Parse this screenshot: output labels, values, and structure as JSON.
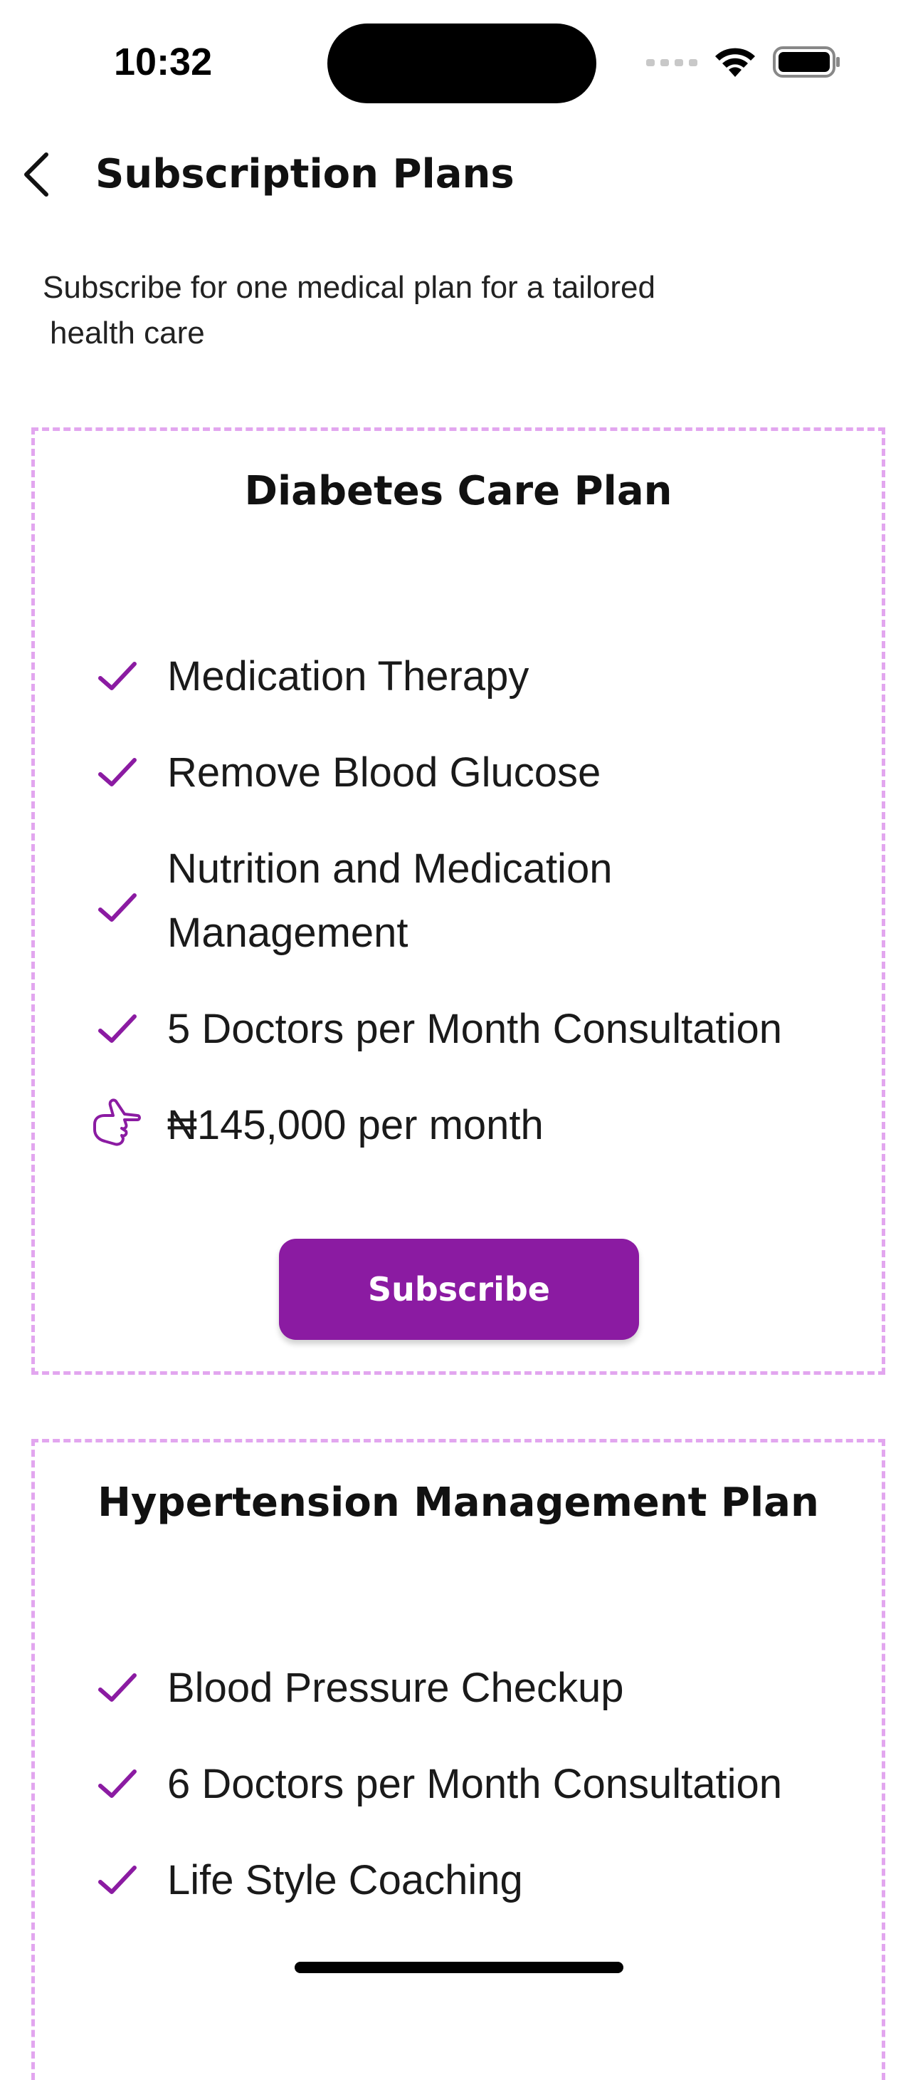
{
  "status_bar": {
    "time": "10:32"
  },
  "header": {
    "title": "Subscription Plans",
    "back_icon": "chevron-left-icon"
  },
  "intro": {
    "line1": "Subscribe for one medical plan for a tailored",
    "line2": "health care"
  },
  "plans": [
    {
      "title": "Diabetes Care Plan",
      "features": [
        "Medication Therapy",
        "Remove Blood Glucose",
        "Nutrition and Medication",
        "Management",
        "5 Doctors per Month Consultation"
      ],
      "price": "₦145,000 per month",
      "subscribe_label": "Subscribe"
    },
    {
      "title": "Hypertension Management Plan",
      "features": [
        "Blood Pressure Checkup",
        "6 Doctors per Month Consultation",
        "Life Style Coaching"
      ]
    }
  ],
  "colors": {
    "accent": "#8b1ba2",
    "card_border": "#e2a6ef",
    "check": "#8b1ba2"
  }
}
